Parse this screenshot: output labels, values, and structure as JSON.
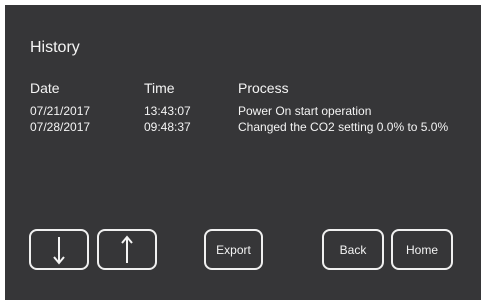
{
  "screen": {
    "title": "History",
    "columns": [
      "Date",
      "Time",
      "Process"
    ],
    "rows": [
      {
        "date": "07/21/2017",
        "time": "13:43:07",
        "process": "Power On start operation"
      },
      {
        "date": "07/28/2017",
        "time": "09:48:37",
        "process": "Changed the CO2 setting 0.0% to 5.0%"
      }
    ]
  },
  "buttons": {
    "down_icon": "arrow-down-icon",
    "up_icon": "arrow-up-icon",
    "export": "Export",
    "back": "Back",
    "home": "Home"
  },
  "colors": {
    "background": "#363638",
    "text": "#f4f4f4",
    "border": "#f0f0f0"
  }
}
